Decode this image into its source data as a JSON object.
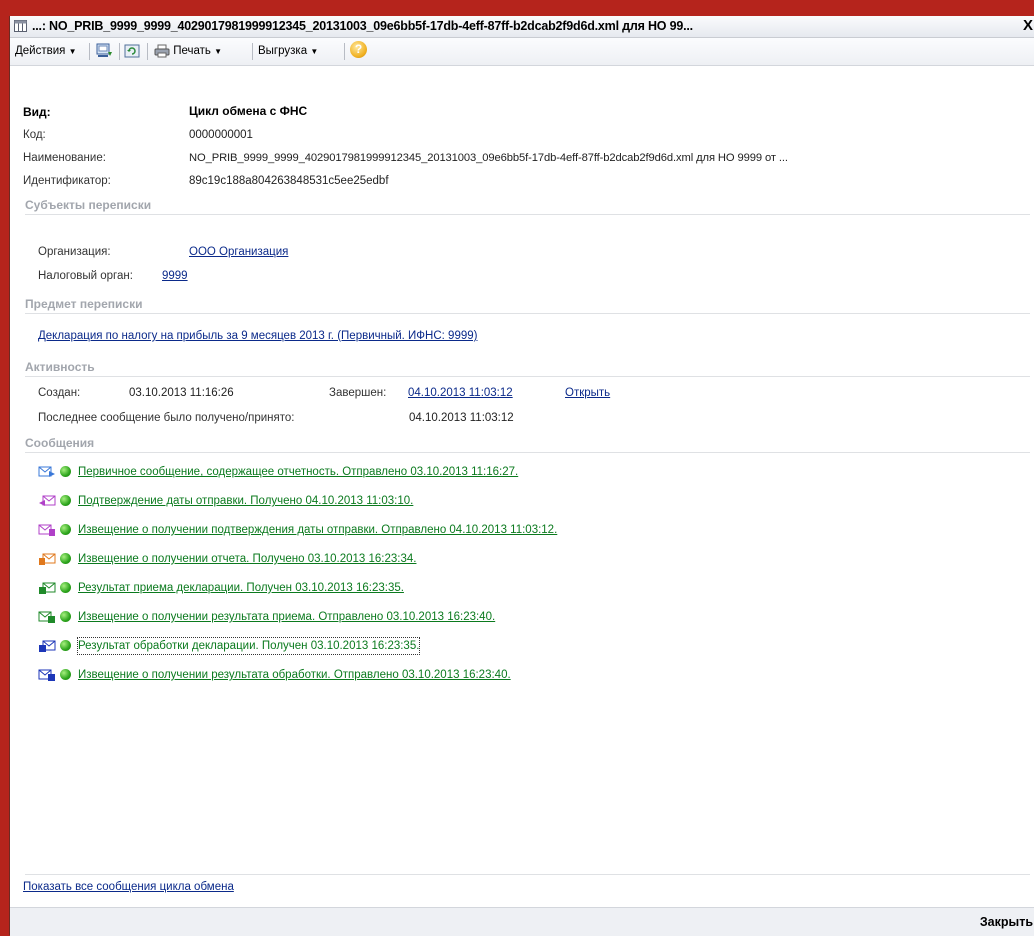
{
  "window": {
    "title": "...: NO_PRIB_9999_9999_4029017981999912345_20131003_09e6bb5f-17db-4eff-87ff-b2dcab2f9d6d.xml для НО 99...",
    "close": "X"
  },
  "toolbar": {
    "actions": "Действия",
    "print": "Печать",
    "export": "Выгрузка",
    "help": "?"
  },
  "header": {
    "kind_label": "Вид:",
    "kind_value": "Цикл обмена с ФНС",
    "code_label": "Код:",
    "code_value": "0000000001",
    "name_label": "Наименование:",
    "name_value": "NO_PRIB_9999_9999_4029017981999912345_20131003_09e6bb5f-17db-4eff-87ff-b2dcab2f9d6d.xml для НО 9999 от ...",
    "id_label": "Идентификатор:",
    "id_value": "89c19c188a804263848531c5ee25edbf"
  },
  "subjects": {
    "title": "Субъекты переписки",
    "org_label": "Организация:",
    "org_value": "ООО Организация",
    "tax_label": "Налоговый орган:",
    "tax_value": "9999"
  },
  "subject_matter": {
    "title": "Предмет переписки",
    "link": "Декларация по налогу на прибыль за 9 месяцев 2013 г. (Первичный. ИФНС: 9999)"
  },
  "activity": {
    "title": "Активность",
    "created_label": "Создан:",
    "created_value": "03.10.2013 11:16:26",
    "finished_label": "Завершен:",
    "finished_value": "04.10.2013 11:03:12",
    "open_link": "Открыть",
    "last_label": "Последнее сообщение было получено/принято:",
    "last_value": "04.10.2013 11:03:12"
  },
  "messages": {
    "title": "Сообщения",
    "items": [
      {
        "text": "Первичное сообщение, содержащее отчетность. Отправлено 03.10.2013 11:16:27.",
        "icon": "envelope-send-blue-icon",
        "color": "#3a78d8"
      },
      {
        "text": "Подтверждение даты отправки. Получено 04.10.2013 11:03:10.",
        "icon": "envelope-receive-purple-icon",
        "color": "#b040c8"
      },
      {
        "text": "Извещение о получении подтверждения даты отправки. Отправлено 04.10.2013 11:03:12.",
        "icon": "envelope-send-purple-icon",
        "color": "#b040c8"
      },
      {
        "text": "Извещение о получении отчета. Получено 03.10.2013 16:23:34.",
        "icon": "envelope-receive-orange-icon",
        "color": "#e0781c"
      },
      {
        "text": "Результат приема декларации. Получен 03.10.2013 16:23:35.",
        "icon": "envelope-receive-green-icon",
        "color": "#1f8a2a"
      },
      {
        "text": "Извещение о получении результата приема. Отправлено 03.10.2013 16:23:40.",
        "icon": "envelope-send-green-icon",
        "color": "#1f8a2a"
      },
      {
        "text": "Результат обработки декларации. Получен 03.10.2013 16:23:35.",
        "icon": "envelope-receive-navy-icon",
        "color": "#1c36b8"
      },
      {
        "text": "Извещение о получении результата обработки. Отправлено 03.10.2013 16:23:40.",
        "icon": "envelope-send-navy-icon",
        "color": "#1c36b8"
      }
    ]
  },
  "footer": {
    "show_all_link": "Показать все сообщения цикла обмена",
    "close_button": "Закрыть"
  }
}
